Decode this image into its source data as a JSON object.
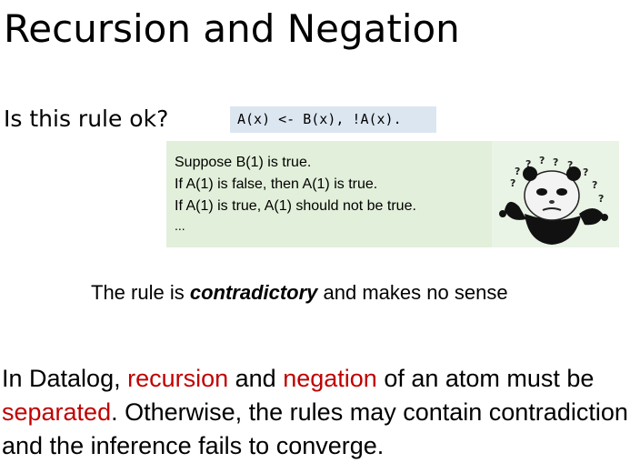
{
  "slide": {
    "title": "Recursion and Negation",
    "question": "Is this rule ok?",
    "rule_code": "A(x) <- B(x), !A(x).",
    "reasoning_lines": [
      "Suppose B(1) is true.",
      "If A(1) is false, then A(1) is true.",
      "If A(1) is true, A(1) should not be true.",
      "..."
    ],
    "conclusion": {
      "before": "The rule is ",
      "emphasis": "contradictory",
      "after": " and makes no sense"
    },
    "statement": {
      "t1": "In Datalog, ",
      "r1": "recursion",
      "t2": " and ",
      "r2": "negation",
      "t3": " of an atom must be ",
      "r3": "separated",
      "t4": ". Otherwise, the rules may contain contradiction and the inference fails to converge."
    },
    "meme_question_marks": "? ? ? ? ? ? ? ?"
  },
  "colors": {
    "highlight_red": "#c00000",
    "code_background": "#dce6f1",
    "reasoning_background": "#e2efda"
  }
}
